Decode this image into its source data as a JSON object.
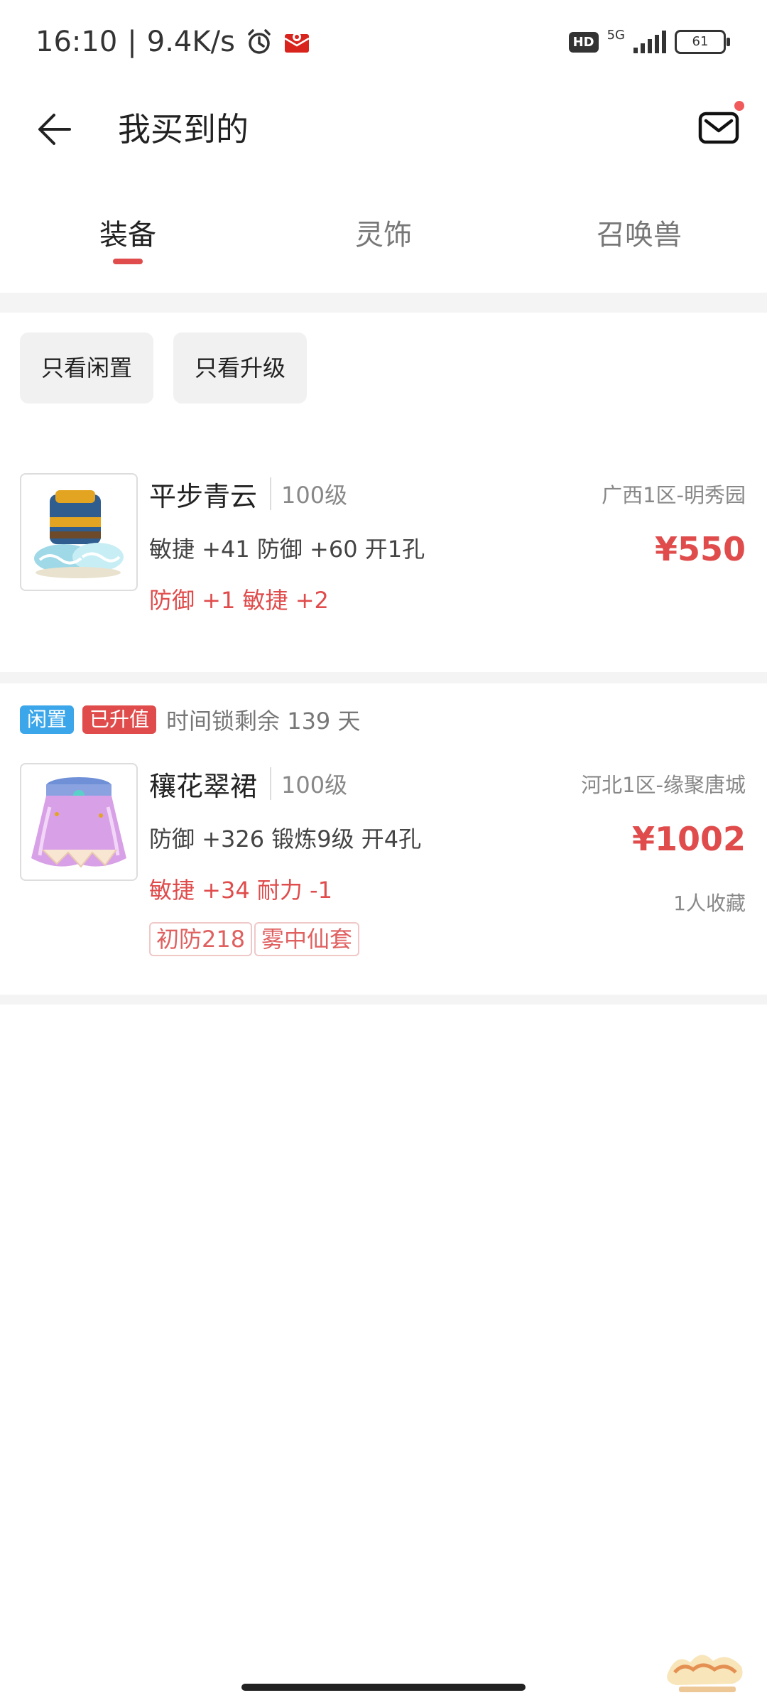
{
  "status_bar": {
    "time": "16:10",
    "separator": "|",
    "net_speed": "9.4K/s",
    "hd": "HD",
    "network": "5G",
    "battery": "61",
    "icons": [
      "alarm-icon",
      "red-envelope-icon",
      "signal-icon",
      "battery-icon"
    ]
  },
  "header": {
    "title": "我买到的",
    "back_icon": "arrow-left-icon",
    "mail_icon": "mail-icon",
    "mail_has_notification": true
  },
  "tabs": [
    {
      "label": "装备",
      "active": true
    },
    {
      "label": "灵饰",
      "active": false
    },
    {
      "label": "召唤兽",
      "active": false
    }
  ],
  "filters": [
    {
      "label": "只看闲置"
    },
    {
      "label": "只看升级"
    }
  ],
  "items": [
    {
      "name": "平步青云",
      "level": "100级",
      "server": "广西1区-明秀园",
      "stats": "敏捷 +41 防御 +60 开1孔",
      "extra": "防御 +1 敏捷 +2",
      "price": "¥550",
      "image": "boots-icon"
    },
    {
      "badges": [
        "闲置",
        "已升值"
      ],
      "lock_text": "时间锁剩余 139 天",
      "name": "穰花翠裙",
      "level": "100级",
      "server": "河北1区-缘聚唐城",
      "stats": "防御 +326 锻炼9级 开4孔",
      "extra": "敏捷 +34 耐力 -1",
      "price": "¥1002",
      "favorites": "1人收藏",
      "tags": [
        "初防218",
        "雾中仙套"
      ],
      "image": "skirt-icon"
    }
  ],
  "colors": {
    "accent": "#e04c4c",
    "idle_badge": "#3ba6ea",
    "band": "#f4f4f4"
  }
}
